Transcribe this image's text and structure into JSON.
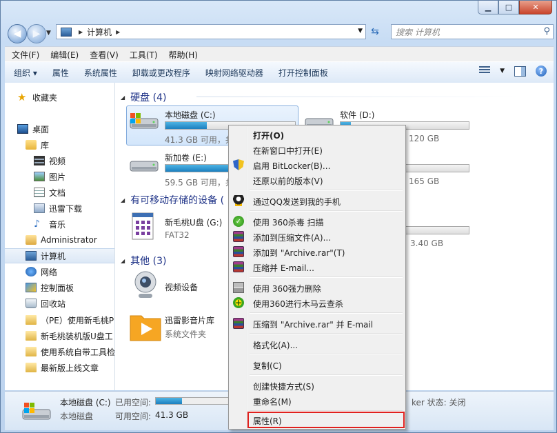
{
  "window": {
    "minimize": "▁",
    "maximize": "□",
    "close": "✕"
  },
  "nav": {
    "back": "◀",
    "forward": "▶"
  },
  "address": {
    "path": "计算机"
  },
  "search": {
    "placeholder": "搜索 计算机"
  },
  "menubar": [
    "文件(F)",
    "编辑(E)",
    "查看(V)",
    "工具(T)",
    "帮助(H)"
  ],
  "toolbar": [
    "组织 ▾",
    "属性",
    "系统属性",
    "卸载或更改程序",
    "映射网络驱动器",
    "打开控制面板"
  ],
  "sidebar": [
    {
      "label": "收藏夹",
      "icon": "star-icon"
    },
    {
      "label": "桌面",
      "icon": "desktop-icon"
    },
    {
      "label": "库",
      "icon": "library-icon"
    },
    {
      "label": "视频",
      "icon": "video-icon"
    },
    {
      "label": "图片",
      "icon": "picture-icon"
    },
    {
      "label": "文档",
      "icon": "document-icon"
    },
    {
      "label": "迅雷下载",
      "icon": "folder-icon"
    },
    {
      "label": "音乐",
      "icon": "music-icon"
    },
    {
      "label": "Administrator",
      "icon": "user-folder-icon"
    },
    {
      "label": "计算机",
      "icon": "computer-icon"
    },
    {
      "label": "网络",
      "icon": "network-icon"
    },
    {
      "label": "控制面板",
      "icon": "control-panel-icon"
    },
    {
      "label": "回收站",
      "icon": "recycle-bin-icon"
    },
    {
      "label": "（PE）使用新毛桃P",
      "icon": "folder-icon"
    },
    {
      "label": "新毛桃装机版U盘工",
      "icon": "folder-icon"
    },
    {
      "label": "使用系统自带工具检",
      "icon": "folder-icon"
    },
    {
      "label": "最新版上线文章",
      "icon": "folder-icon"
    }
  ],
  "groups": {
    "hard_disks": "硬盘 (4)",
    "removable": "有可移动存储的设备 (",
    "other": "其他 (3)"
  },
  "drives": [
    {
      "name": "本地磁盘 (C:)",
      "info": "41.3 GB 可用，共",
      "used_fraction": 0.32
    },
    {
      "name": "软件 (D:)",
      "info": "120 GB",
      "used_fraction": 0.08
    },
    {
      "name": "新加卷 (E:)",
      "info": "59.5 GB 可用，共",
      "used_fraction": 0.55
    },
    {
      "name": "",
      "info": "165 GB",
      "used_fraction": 0.3
    }
  ],
  "removable_devices": [
    {
      "name": "新毛桃U盘 (G:)",
      "info": "FAT32"
    },
    {
      "name": "",
      "info": "3.40 GB",
      "used_fraction": 0.4
    }
  ],
  "other_items": [
    {
      "name": "视频设备",
      "info": ""
    },
    {
      "name": "迅雷影音片库",
      "info": "系统文件夹"
    }
  ],
  "statusbar": {
    "name": "本地磁盘 (C:)",
    "type": "本地磁盘",
    "used_label": "已用空间:",
    "free_label": "可用空间:",
    "free_value": "41.3 GB",
    "used_fraction": 0.35,
    "bitlocker": "ker 状态: 关闭"
  },
  "context_menu": [
    {
      "label": "打开(O)",
      "bold": true,
      "icon": ""
    },
    {
      "label": "在新窗口中打开(E)",
      "icon": ""
    },
    {
      "label": "启用 BitLocker(B)...",
      "icon": "shield-icon"
    },
    {
      "label": "还原以前的版本(V)",
      "icon": ""
    },
    {
      "label": "通过QQ发送到我的手机",
      "icon": "qq-icon"
    },
    {
      "label": "使用 360杀毒 扫描",
      "icon": "360-antivirus-icon"
    },
    {
      "label": "添加到压缩文件(A)...",
      "icon": "winrar-icon"
    },
    {
      "label": "添加到 \"Archive.rar\"(T)",
      "icon": "winrar-icon"
    },
    {
      "label": "压缩并 E-mail...",
      "icon": "winrar-icon"
    },
    {
      "label": "使用 360强力删除",
      "icon": "shredder-icon"
    },
    {
      "label": "使用360进行木马云查杀",
      "icon": "360-trojan-icon"
    },
    {
      "label": "压缩到 \"Archive.rar\" 并 E-mail",
      "icon": "winrar-icon"
    },
    {
      "label": "格式化(A)...",
      "icon": ""
    },
    {
      "label": "复制(C)",
      "icon": ""
    },
    {
      "label": "创建快捷方式(S)",
      "icon": ""
    },
    {
      "label": "重命名(M)",
      "icon": ""
    },
    {
      "label": "属性(R)",
      "icon": "",
      "highlighted": true
    }
  ]
}
